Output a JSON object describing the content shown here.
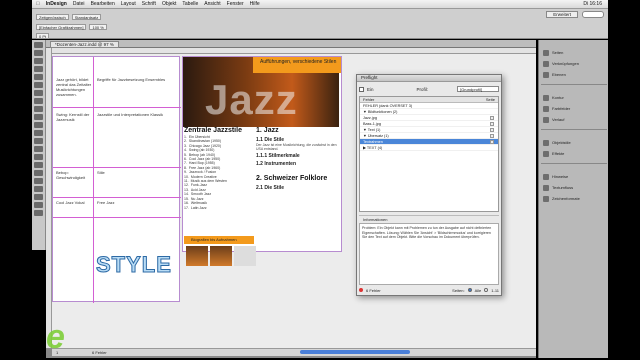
{
  "menubar": {
    "apple": "",
    "app": "InDesign",
    "items": [
      "Datei",
      "Bearbeiten",
      "Layout",
      "Schrift",
      "Objekt",
      "Tabelle",
      "Ansicht",
      "Fenster",
      "Hilfe"
    ],
    "clock": "Di 16:16"
  },
  "control": {
    "workspace": "Erweitert",
    "chips": [
      "Zeitgenössisch",
      "Standardsatz",
      "[Einfacher Grafikrahmen]",
      "100 %",
      "0 Pt"
    ]
  },
  "document": {
    "tab_title": "*Dozenten-Jazz.indd @ 97 %"
  },
  "left_page": {
    "cells": [
      "Jazz gehört, bildet zentral das Zeitalter Musikrichtungen zusammen.",
      "Begriffe für Jazzbesetzung Ensembles",
      "Swing: Kernstil der Jazzmusik",
      "Jazzstile und Interpretationen Klassik",
      "Bebop: Geschwindigkeit",
      "Stile",
      "Cool Jazz Vokal",
      "Free Jazz"
    ],
    "style_title": "STYLE"
  },
  "right_page": {
    "orange_box": "Aufführungen, verschiedene Stilen",
    "jazz_word": "Jazz",
    "col1_heading": "Zentrale Jazzstile",
    "col1_items": [
      [
        "1.",
        "Ein Übersicht"
      ],
      [
        "2.",
        "Skandinavian (1950)"
      ],
      [
        "3.",
        "Chicago Jazz (1920)"
      ],
      [
        "4.",
        "Swing (ab 1930)"
      ],
      [
        "5.",
        "Bebop (ab 1940)"
      ],
      [
        "6.",
        "Cool Jazz (ab 1950)"
      ],
      [
        "7.",
        "Hard Bop (1955)"
      ],
      [
        "8.",
        "Free Jazz (ab 1960)"
      ],
      [
        "9.",
        "Jazzrock / Fusion"
      ],
      [
        "10.",
        "Modern Creative"
      ],
      [
        "11.",
        "Musik aus dem Westen"
      ],
      [
        "12.",
        "Funk-Jazz"
      ],
      [
        "13.",
        "Acid Jazz"
      ],
      [
        "14.",
        "Smooth Jazz"
      ],
      [
        "15.",
        "Nu Jazz"
      ],
      [
        "16.",
        "Weltmusik"
      ],
      [
        "17.",
        "Latin Jazz"
      ]
    ],
    "orange_bar": "Biografien bis Aufnahmen",
    "col2_heading_num": "1.",
    "col2_heading": "Jazz",
    "col2_sub1_num": "1.1",
    "col2_sub1": "Die Stile",
    "col2_text1": "Der Jazz ist eine Musikrichtung, die zunächst in den USA entstand.",
    "col2_sub2_num": "1.1.1",
    "col2_sub2": "Stilmerkmale",
    "col2_sub3_num": "1.2",
    "col2_sub3": "Instrumenten",
    "col2_heading2_num": "2.",
    "col2_heading2": "Schweizer Folklore",
    "col2_sub4_num": "2.1",
    "col2_sub4": "Die Stile"
  },
  "preflight": {
    "title": "Preflight",
    "on_label": "Ein",
    "profile_label": "Profil:",
    "profile_value": "[Grundprofil]",
    "col_error": "Fehler",
    "col_page": "Seite",
    "rows": [
      "FEHLER (dank OVERSET 3)",
      "▼ Bildfunktionen (2)",
      "   Jazz.jpg",
      "   Bass-1.jpg",
      "▼ Text (1)",
      "▼ Übersatz (1)",
      "      Textrahmen",
      "▶ TEXT (4)"
    ],
    "selected_row": 6,
    "info_heading": "Informationen",
    "info_text": "Problem: Ein Objekt kann mit Problemen zu tun der Ausgabe auf nicht definierten Eigenschaften. Lösung: Wählen Sie 'Ansicht' > 'Bildschirmmodus' und korrigieren Sie den Text auf dem Objekt. Bitte die Vorschau im Dokument überprüfen.",
    "footer_errors": "6 Fehler",
    "footer_pages_label": "Seiten:",
    "footer_all": "Alle",
    "footer_range": "1-11"
  },
  "dock": {
    "items": [
      "Seiten",
      "Verknüpfungen",
      "Ebenen",
      "Kontur",
      "Farbfelder",
      "Verlauf",
      "Objektstile",
      "Effekte",
      "Hinweise",
      "Textumfluss",
      "Zeichenformate"
    ]
  },
  "hscroll": {
    "page_label": "1",
    "errors": "6 Fehler"
  },
  "colors": {
    "orange": "#f39a1c",
    "selection": "#4a86d8",
    "guide_magenta": "#d35fd3",
    "style_blue": "#2d6aa5",
    "logo_green": "#7fcf3a"
  }
}
